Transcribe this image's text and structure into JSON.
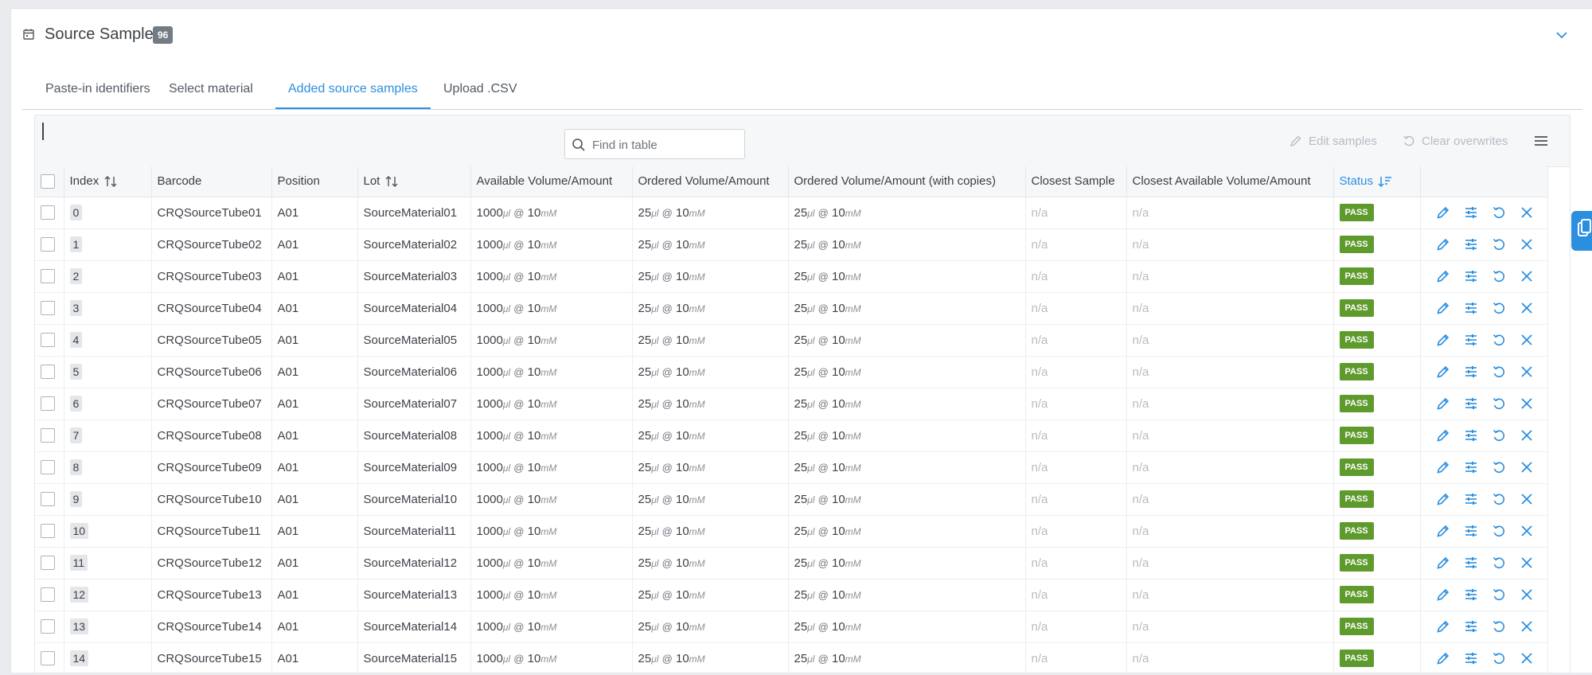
{
  "panel": {
    "title": "Source Sample",
    "count": "96",
    "icons": {
      "title": "calendar-icon",
      "collapse": "chevron-down-icon"
    }
  },
  "tabs": [
    {
      "label": "Paste-in identifiers",
      "active": false
    },
    {
      "label": "Select material",
      "active": false
    },
    {
      "label": "Added source samples",
      "active": true
    },
    {
      "label": "Upload .CSV",
      "active": false
    }
  ],
  "toolbar": {
    "search_placeholder": "Find in table",
    "edit_samples_label": "Edit samples",
    "clear_overwrites_label": "Clear overwrites",
    "menu_icon": "hamburger-menu-icon"
  },
  "columns": [
    "Index",
    "Barcode",
    "Position",
    "Lot",
    "Available Volume/Amount",
    "Ordered Volume/Amount",
    "Ordered Volume/Amount (with copies)",
    "Closest Sample",
    "Closest Available Volume/Amount",
    "Status"
  ],
  "volume_units": {
    "volume": "μl",
    "separator": "@",
    "concentration": "mM"
  },
  "rows": [
    {
      "index": "0",
      "barcode": "CRQSourceTube01",
      "position": "A01",
      "lot": "SourceMaterial01",
      "avail_vol": "1000",
      "avail_conc": "10",
      "ord_vol": "25",
      "ord_conc": "10",
      "copies_vol": "25",
      "copies_conc": "10",
      "closest_sample": "n/a",
      "closest_avail": "n/a",
      "status": "PASS"
    },
    {
      "index": "1",
      "barcode": "CRQSourceTube02",
      "position": "A01",
      "lot": "SourceMaterial02",
      "avail_vol": "1000",
      "avail_conc": "10",
      "ord_vol": "25",
      "ord_conc": "10",
      "copies_vol": "25",
      "copies_conc": "10",
      "closest_sample": "n/a",
      "closest_avail": "n/a",
      "status": "PASS"
    },
    {
      "index": "2",
      "barcode": "CRQSourceTube03",
      "position": "A01",
      "lot": "SourceMaterial03",
      "avail_vol": "1000",
      "avail_conc": "10",
      "ord_vol": "25",
      "ord_conc": "10",
      "copies_vol": "25",
      "copies_conc": "10",
      "closest_sample": "n/a",
      "closest_avail": "n/a",
      "status": "PASS"
    },
    {
      "index": "3",
      "barcode": "CRQSourceTube04",
      "position": "A01",
      "lot": "SourceMaterial04",
      "avail_vol": "1000",
      "avail_conc": "10",
      "ord_vol": "25",
      "ord_conc": "10",
      "copies_vol": "25",
      "copies_conc": "10",
      "closest_sample": "n/a",
      "closest_avail": "n/a",
      "status": "PASS"
    },
    {
      "index": "4",
      "barcode": "CRQSourceTube05",
      "position": "A01",
      "lot": "SourceMaterial05",
      "avail_vol": "1000",
      "avail_conc": "10",
      "ord_vol": "25",
      "ord_conc": "10",
      "copies_vol": "25",
      "copies_conc": "10",
      "closest_sample": "n/a",
      "closest_avail": "n/a",
      "status": "PASS"
    },
    {
      "index": "5",
      "barcode": "CRQSourceTube06",
      "position": "A01",
      "lot": "SourceMaterial06",
      "avail_vol": "1000",
      "avail_conc": "10",
      "ord_vol": "25",
      "ord_conc": "10",
      "copies_vol": "25",
      "copies_conc": "10",
      "closest_sample": "n/a",
      "closest_avail": "n/a",
      "status": "PASS"
    },
    {
      "index": "6",
      "barcode": "CRQSourceTube07",
      "position": "A01",
      "lot": "SourceMaterial07",
      "avail_vol": "1000",
      "avail_conc": "10",
      "ord_vol": "25",
      "ord_conc": "10",
      "copies_vol": "25",
      "copies_conc": "10",
      "closest_sample": "n/a",
      "closest_avail": "n/a",
      "status": "PASS"
    },
    {
      "index": "7",
      "barcode": "CRQSourceTube08",
      "position": "A01",
      "lot": "SourceMaterial08",
      "avail_vol": "1000",
      "avail_conc": "10",
      "ord_vol": "25",
      "ord_conc": "10",
      "copies_vol": "25",
      "copies_conc": "10",
      "closest_sample": "n/a",
      "closest_avail": "n/a",
      "status": "PASS"
    },
    {
      "index": "8",
      "barcode": "CRQSourceTube09",
      "position": "A01",
      "lot": "SourceMaterial09",
      "avail_vol": "1000",
      "avail_conc": "10",
      "ord_vol": "25",
      "ord_conc": "10",
      "copies_vol": "25",
      "copies_conc": "10",
      "closest_sample": "n/a",
      "closest_avail": "n/a",
      "status": "PASS"
    },
    {
      "index": "9",
      "barcode": "CRQSourceTube10",
      "position": "A01",
      "lot": "SourceMaterial10",
      "avail_vol": "1000",
      "avail_conc": "10",
      "ord_vol": "25",
      "ord_conc": "10",
      "copies_vol": "25",
      "copies_conc": "10",
      "closest_sample": "n/a",
      "closest_avail": "n/a",
      "status": "PASS"
    },
    {
      "index": "10",
      "barcode": "CRQSourceTube11",
      "position": "A01",
      "lot": "SourceMaterial11",
      "avail_vol": "1000",
      "avail_conc": "10",
      "ord_vol": "25",
      "ord_conc": "10",
      "copies_vol": "25",
      "copies_conc": "10",
      "closest_sample": "n/a",
      "closest_avail": "n/a",
      "status": "PASS"
    },
    {
      "index": "11",
      "barcode": "CRQSourceTube12",
      "position": "A01",
      "lot": "SourceMaterial12",
      "avail_vol": "1000",
      "avail_conc": "10",
      "ord_vol": "25",
      "ord_conc": "10",
      "copies_vol": "25",
      "copies_conc": "10",
      "closest_sample": "n/a",
      "closest_avail": "n/a",
      "status": "PASS"
    },
    {
      "index": "12",
      "barcode": "CRQSourceTube13",
      "position": "A01",
      "lot": "SourceMaterial13",
      "avail_vol": "1000",
      "avail_conc": "10",
      "ord_vol": "25",
      "ord_conc": "10",
      "copies_vol": "25",
      "copies_conc": "10",
      "closest_sample": "n/a",
      "closest_avail": "n/a",
      "status": "PASS"
    },
    {
      "index": "13",
      "barcode": "CRQSourceTube14",
      "position": "A01",
      "lot": "SourceMaterial14",
      "avail_vol": "1000",
      "avail_conc": "10",
      "ord_vol": "25",
      "ord_conc": "10",
      "copies_vol": "25",
      "copies_conc": "10",
      "closest_sample": "n/a",
      "closest_avail": "n/a",
      "status": "PASS"
    },
    {
      "index": "14",
      "barcode": "CRQSourceTube15",
      "position": "A01",
      "lot": "SourceMaterial15",
      "avail_vol": "1000",
      "avail_conc": "10",
      "ord_vol": "25",
      "ord_conc": "10",
      "copies_vol": "25",
      "copies_conc": "10",
      "closest_sample": "n/a",
      "closest_avail": "n/a",
      "status": "PASS"
    }
  ],
  "row_actions": [
    "pencil-icon",
    "sliders-icon",
    "undo-icon",
    "close-icon"
  ],
  "colors": {
    "accent": "#2b8fe0",
    "pass": "#5e9a2c",
    "badge": "#737b84"
  }
}
